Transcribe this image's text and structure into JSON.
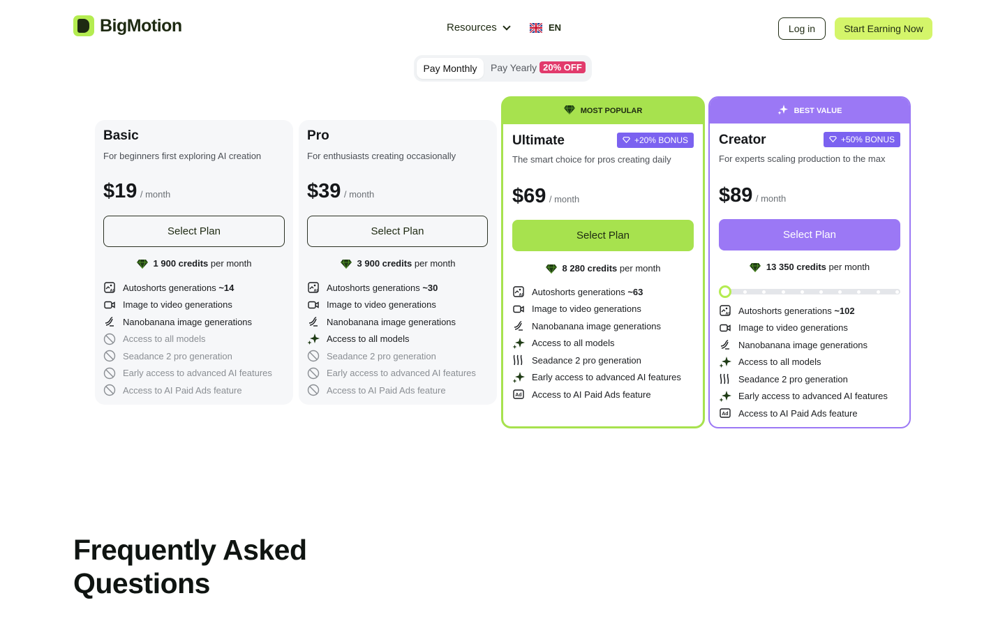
{
  "header": {
    "logo_text": "BigMotion",
    "nav_resources": "Resources",
    "lang": "EN",
    "login": "Log in",
    "cta": "Start Earning Now"
  },
  "billing": {
    "monthly": "Pay Monthly",
    "yearly": "Pay Yearly",
    "discount": "20% OFF",
    "selected": "Pay Monthly"
  },
  "plans": [
    {
      "name": "Basic",
      "desc": "For beginners first exploring AI creation",
      "price": "$19",
      "per": "/ month",
      "button": "Select Plan",
      "credits_value": "1 900 credits",
      "credits_suffix": "per month",
      "features": [
        {
          "pre": "Autoshorts generations ",
          "bold": "~14",
          "icon": "autoshorts-icon",
          "enabled": true
        },
        {
          "pre": "Image to video generations",
          "bold": "",
          "icon": "video-icon",
          "enabled": true
        },
        {
          "pre": "Nanobanana image generations",
          "bold": "",
          "icon": "nanobanana-icon",
          "enabled": true
        },
        {
          "pre": "Access to all models",
          "bold": "",
          "icon": "disabled-icon",
          "enabled": false
        },
        {
          "pre": "Seadance 2 pro generation",
          "bold": "",
          "icon": "disabled-icon",
          "enabled": false
        },
        {
          "pre": "Early access to advanced AI features",
          "bold": "",
          "icon": "disabled-icon",
          "enabled": false
        },
        {
          "pre": "Access to AI Paid Ads feature",
          "bold": "",
          "icon": "disabled-icon",
          "enabled": false
        }
      ]
    },
    {
      "name": "Pro",
      "desc": "For enthusiasts creating occasionally",
      "price": "$39",
      "per": "/ month",
      "button": "Select Plan",
      "credits_value": "3 900 credits",
      "credits_suffix": "per month",
      "features": [
        {
          "pre": "Autoshorts generations ",
          "bold": "~30",
          "icon": "autoshorts-icon",
          "enabled": true
        },
        {
          "pre": "Image to video generations",
          "bold": "",
          "icon": "video-icon",
          "enabled": true
        },
        {
          "pre": "Nanobanana image generations",
          "bold": "",
          "icon": "nanobanana-icon",
          "enabled": true
        },
        {
          "pre": "Access to all models",
          "bold": "",
          "icon": "sparkle-icon",
          "enabled": true
        },
        {
          "pre": "Seadance 2 pro generation",
          "bold": "",
          "icon": "disabled-icon",
          "enabled": false
        },
        {
          "pre": "Early access to advanced AI features",
          "bold": "",
          "icon": "disabled-icon",
          "enabled": false
        },
        {
          "pre": "Access to AI Paid Ads feature",
          "bold": "",
          "icon": "disabled-icon",
          "enabled": false
        }
      ]
    },
    {
      "name": "Ultimate",
      "banner": "MOST POPULAR",
      "bonus": "+20% BONUS",
      "desc": "The smart choice for pros creating daily",
      "price": "$69",
      "per": "/ month",
      "button": "Select Plan",
      "credits_value": "8 280 credits",
      "credits_suffix": "per month",
      "features": [
        {
          "pre": "Autoshorts generations ",
          "bold": "~63",
          "icon": "autoshorts-icon",
          "enabled": true
        },
        {
          "pre": "Image to video generations",
          "bold": "",
          "icon": "video-icon",
          "enabled": true
        },
        {
          "pre": "Nanobanana image generations",
          "bold": "",
          "icon": "nanobanana-icon",
          "enabled": true
        },
        {
          "pre": "Access to all models",
          "bold": "",
          "icon": "sparkle-icon",
          "enabled": true
        },
        {
          "pre": "Seadance 2 pro generation",
          "bold": "",
          "icon": "seadance-icon",
          "enabled": true
        },
        {
          "pre": "Early access to advanced AI features",
          "bold": "",
          "icon": "sparkle-icon",
          "enabled": true
        },
        {
          "pre": "Access to AI Paid Ads feature",
          "bold": "",
          "icon": "ads-icon",
          "enabled": true
        }
      ]
    },
    {
      "name": "Creator",
      "banner": "BEST VALUE",
      "bonus": "+50% BONUS",
      "desc": "For experts scaling production to the max",
      "price": "$89",
      "per": "/ month",
      "button": "Select Plan",
      "credits_value": "13 350 credits",
      "credits_suffix": "per month",
      "slider_position": 0,
      "features": [
        {
          "pre": "Autoshorts generations ",
          "bold": "~102",
          "icon": "autoshorts-icon",
          "enabled": true
        },
        {
          "pre": "Image to video generations",
          "bold": "",
          "icon": "video-icon",
          "enabled": true
        },
        {
          "pre": "Nanobanana image generations",
          "bold": "",
          "icon": "nanobanana-icon",
          "enabled": true
        },
        {
          "pre": "Access to all models",
          "bold": "",
          "icon": "sparkle-icon",
          "enabled": true
        },
        {
          "pre": "Seadance 2 pro generation",
          "bold": "",
          "icon": "seadance-icon",
          "enabled": true
        },
        {
          "pre": "Early access to advanced AI features",
          "bold": "",
          "icon": "sparkle-icon",
          "enabled": true
        },
        {
          "pre": "Access to AI Paid Ads feature",
          "bold": "",
          "icon": "ads-icon",
          "enabled": true
        }
      ]
    }
  ],
  "faq": {
    "title": "Frequently Asked Questions"
  },
  "colors": {
    "accent_green": "#a7e24e",
    "lime_cta": "#d4f56a",
    "purple": "#9b78f5",
    "bonus_purple": "#7b62f0",
    "discount_pink": "#e23b6c"
  }
}
